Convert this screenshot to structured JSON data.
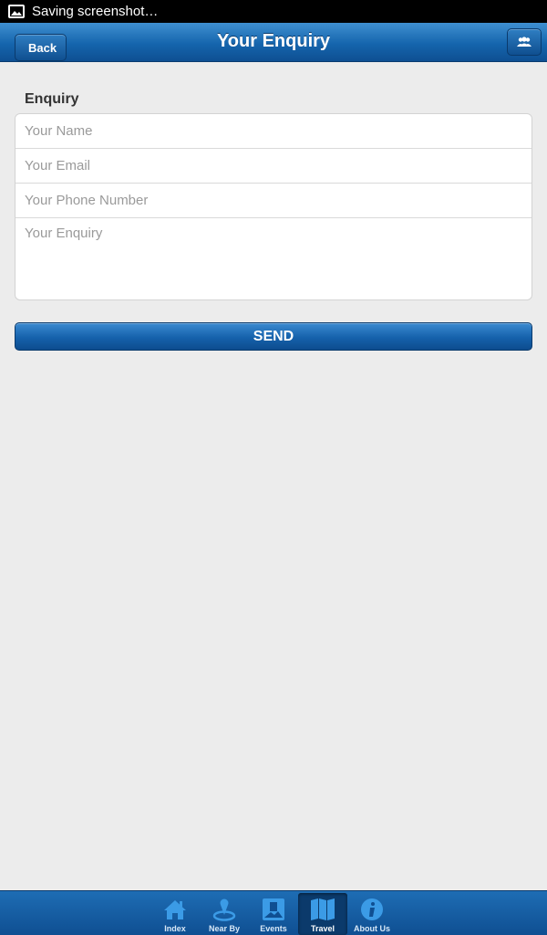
{
  "status_bar": {
    "notification": "Saving screenshot…"
  },
  "header": {
    "back_label": "Back",
    "title": "Your Enquiry"
  },
  "form": {
    "section_label": "Enquiry",
    "name_placeholder": "Your Name",
    "email_placeholder": "Your Email",
    "phone_placeholder": "Your Phone Number",
    "enquiry_placeholder": "Your Enquiry",
    "send_label": "SEND"
  },
  "tabs": [
    {
      "label": "Index",
      "icon": "home-icon",
      "active": false
    },
    {
      "label": "Near By",
      "icon": "location-pin-icon",
      "active": false
    },
    {
      "label": "Events",
      "icon": "events-icon",
      "active": false
    },
    {
      "label": "Travel",
      "icon": "map-icon",
      "active": true
    },
    {
      "label": "About Us",
      "icon": "info-icon",
      "active": false
    }
  ],
  "colors": {
    "accent": "#1565ad",
    "icon_blue": "#3b9be6",
    "background": "#ececec"
  }
}
